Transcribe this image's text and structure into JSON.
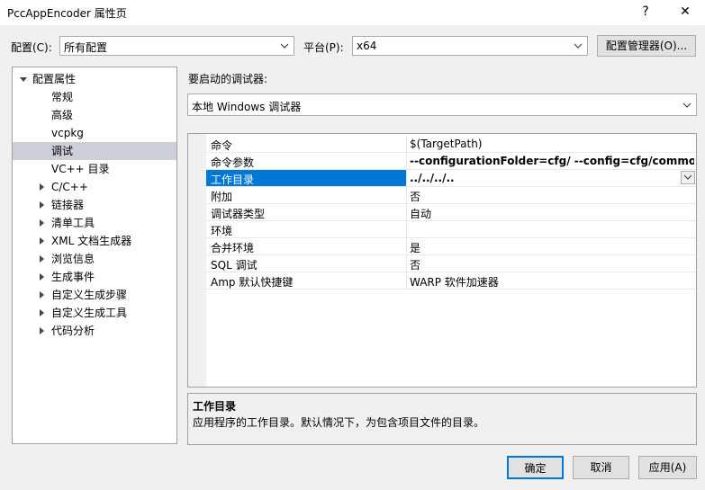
{
  "window": {
    "title": "PccAppEncoder 属性页",
    "help_glyph": "?",
    "close_glyph": "✕"
  },
  "config_row": {
    "config_label": "配置(C):",
    "config_value": "所有配置",
    "platform_label": "平台(P):",
    "platform_value": "x64",
    "manager_button": "配置管理器(O)..."
  },
  "tree": {
    "root": "配置属性",
    "items": [
      {
        "label": "常规",
        "expandable": false,
        "selected": false
      },
      {
        "label": "高级",
        "expandable": false,
        "selected": false
      },
      {
        "label": "vcpkg",
        "expandable": false,
        "selected": false
      },
      {
        "label": "调试",
        "expandable": false,
        "selected": true
      },
      {
        "label": "VC++ 目录",
        "expandable": false,
        "selected": false
      },
      {
        "label": "C/C++",
        "expandable": true,
        "selected": false
      },
      {
        "label": "链接器",
        "expandable": true,
        "selected": false
      },
      {
        "label": "清单工具",
        "expandable": true,
        "selected": false
      },
      {
        "label": "XML 文档生成器",
        "expandable": true,
        "selected": false
      },
      {
        "label": "浏览信息",
        "expandable": true,
        "selected": false
      },
      {
        "label": "生成事件",
        "expandable": true,
        "selected": false
      },
      {
        "label": "自定义生成步骤",
        "expandable": true,
        "selected": false
      },
      {
        "label": "自定义生成工具",
        "expandable": true,
        "selected": false
      },
      {
        "label": "代码分析",
        "expandable": true,
        "selected": false
      }
    ]
  },
  "debugger": {
    "label": "要启动的调试器:",
    "value": "本地 Windows 调试器"
  },
  "properties": [
    {
      "name": "命令",
      "value": "$(TargetPath)",
      "bold": false,
      "selected": false
    },
    {
      "name": "命令参数",
      "value": "--configurationFolder=cfg/  --config=cfg/common/",
      "bold": true,
      "selected": false
    },
    {
      "name": "工作目录",
      "value": "../../../..",
      "bold": true,
      "selected": true
    },
    {
      "name": "附加",
      "value": "否",
      "bold": false,
      "selected": false
    },
    {
      "name": "调试器类型",
      "value": "自动",
      "bold": false,
      "selected": false
    },
    {
      "name": "环境",
      "value": "",
      "bold": false,
      "selected": false
    },
    {
      "name": "合并环境",
      "value": "是",
      "bold": false,
      "selected": false
    },
    {
      "name": "SQL 调试",
      "value": "否",
      "bold": false,
      "selected": false
    },
    {
      "name": "Amp 默认快捷键",
      "value": "WARP 软件加速器",
      "bold": false,
      "selected": false
    }
  ],
  "description": {
    "title": "工作目录",
    "text": "应用程序的工作目录。默认情况下，为包含项目文件的目录。"
  },
  "buttons": {
    "ok": "确定",
    "cancel": "取消",
    "apply": "应用(A)"
  },
  "colors": {
    "selection_blue": "#0078d7",
    "tree_selection": "#cccedb",
    "primary_button_border": "#0078d7"
  }
}
